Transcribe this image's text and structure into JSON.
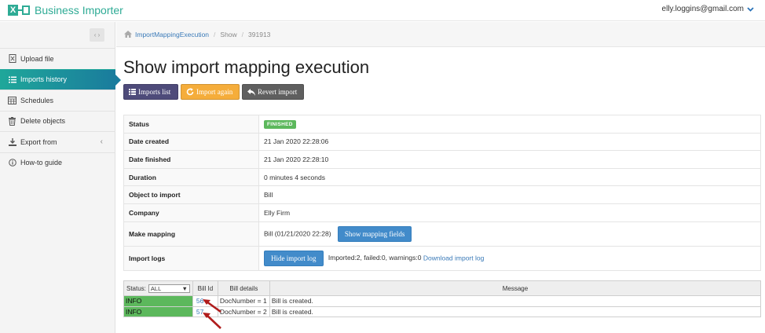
{
  "app": {
    "logo_mark": "X",
    "name": "Business Importer",
    "user_email": "elly.loggins@gmail.com"
  },
  "breadcrumb": {
    "link": "ImportMappingExecution",
    "current": "Show",
    "id": "391913"
  },
  "sidebar": {
    "items": [
      {
        "label": "Upload file",
        "icon": "upload-file-icon"
      },
      {
        "label": "Imports history",
        "icon": "list-icon"
      },
      {
        "label": "Schedules",
        "icon": "calendar-icon"
      },
      {
        "label": "Delete objects",
        "icon": "trash-icon"
      },
      {
        "label": "Export from",
        "icon": "download-icon"
      },
      {
        "label": "How-to guide",
        "icon": "info-icon"
      }
    ]
  },
  "page": {
    "title": "Show import mapping execution"
  },
  "actions": {
    "imports_list": "Imports list",
    "import_again": "Import again",
    "revert_import": "Revert import"
  },
  "details": {
    "status_label": "Status",
    "status_value": "FINISHED",
    "date_created_label": "Date created",
    "date_created_value": "21 Jan 2020 22:28:06",
    "date_finished_label": "Date finished",
    "date_finished_value": "21 Jan 2020 22:28:10",
    "duration_label": "Duration",
    "duration_value": "0 minutes 4 seconds",
    "object_label": "Object to import",
    "object_value": "Bill",
    "company_label": "Company",
    "company_value": "Elly Firm",
    "mapping_label": "Make mapping",
    "mapping_value": "Bill (01/21/2020 22:28)",
    "mapping_button": "Show mapping fields",
    "logs_label": "Import logs",
    "logs_button": "Hide import log",
    "logs_summary": "Imported:2, failed:0, warnings:0",
    "logs_download": "Download import log"
  },
  "logs": {
    "status_label": "Status:",
    "status_selected": "ALL",
    "headers": {
      "bill_id": "Bill Id",
      "bill_details": "Bill details",
      "message": "Message"
    },
    "rows": [
      {
        "status": "INFO",
        "bill_id": "56",
        "details": "DocNumber = 1",
        "message": "Bill is created."
      },
      {
        "status": "INFO",
        "bill_id": "57",
        "details": "DocNumber = 2",
        "message": "Bill is created."
      }
    ]
  },
  "colors": {
    "brand": "#2eab95",
    "active_nav": "#1a7c9d",
    "success": "#5cb85c",
    "primary": "#428bca",
    "warning": "#f5ad3b",
    "annotation_arrow": "#b01c1c"
  }
}
